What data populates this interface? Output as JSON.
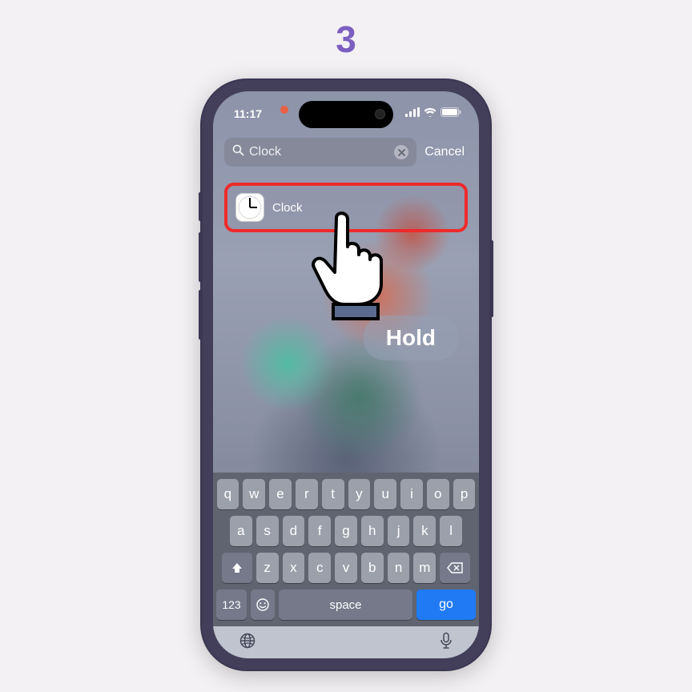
{
  "step_number": "3",
  "status": {
    "time": "11:17"
  },
  "search": {
    "query": "Clock",
    "cancel_label": "Cancel"
  },
  "result": {
    "app_name": "Clock"
  },
  "instruction_pill": "Hold",
  "keyboard": {
    "row1": [
      "q",
      "w",
      "e",
      "r",
      "t",
      "y",
      "u",
      "i",
      "o",
      "p"
    ],
    "row2": [
      "a",
      "s",
      "d",
      "f",
      "g",
      "h",
      "j",
      "k",
      "l"
    ],
    "row3": [
      "z",
      "x",
      "c",
      "v",
      "b",
      "n",
      "m"
    ],
    "num_label": "123",
    "space_label": "space",
    "go_label": "go"
  }
}
